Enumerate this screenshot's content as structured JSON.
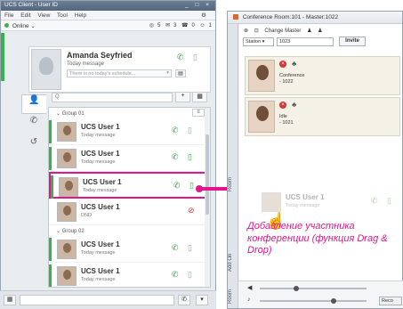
{
  "client": {
    "title": "UCS Client - User ID",
    "window_controls": "_ □ ×",
    "menu": [
      "File",
      "Edit",
      "View",
      "Tool",
      "Help"
    ],
    "status": "Online",
    "status_caret": "⌄",
    "counts": [
      "5",
      "3",
      "0",
      "1"
    ],
    "profile": {
      "name": "Amanda Seyfried",
      "message": "Today message",
      "schedule_placeholder": "There is no today's schedule..."
    },
    "search_placeholder": "Q",
    "groups": [
      {
        "label": "Group 01",
        "users": [
          {
            "name": "UCS User 1",
            "message": "Today message"
          },
          {
            "name": "UCS User 1",
            "message": "Today message"
          },
          {
            "name": "UCS User 1",
            "message": "Today message"
          },
          {
            "name": "UCS User 1",
            "message": "DND"
          }
        ]
      },
      {
        "label": "Group 02",
        "users": [
          {
            "name": "UCS User 1",
            "message": "Today message"
          },
          {
            "name": "UCS User 1",
            "message": "Today message"
          }
        ]
      }
    ]
  },
  "conference": {
    "title": "Conference Room:101 - Master:1022",
    "change_master": "Change Master",
    "station_select": "Station",
    "number_value": "1023",
    "invite_label": "Invite",
    "participants": [
      {
        "status": "Conference",
        "ext": "- 1022"
      },
      {
        "status": "Idle",
        "ext": "- 1021"
      }
    ],
    "dragged": {
      "name": "UCS User 1",
      "message": "Today message"
    },
    "side_tabs": [
      "Room",
      "Add On",
      "Room"
    ],
    "record_label": "Reco"
  },
  "caption": "Добавление участника конференции (функция Drag & Drop)",
  "colors": {
    "accent": "#e1168c",
    "online": "#35b24a",
    "dnd": "#d23a3a"
  }
}
